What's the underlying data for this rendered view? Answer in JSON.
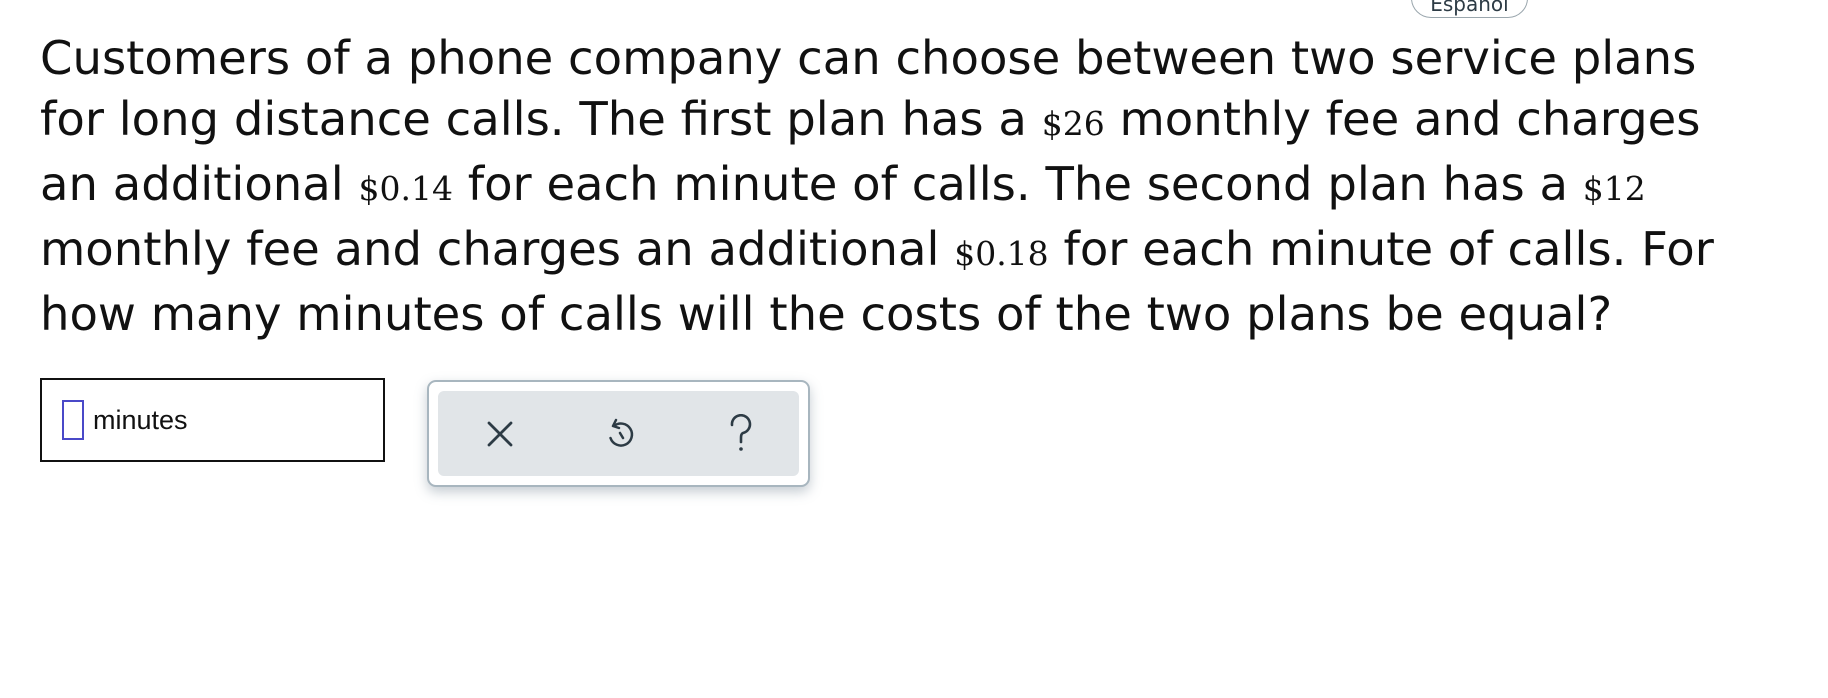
{
  "header": {
    "language_toggle": "Español"
  },
  "question": {
    "lines": [
      [
        "Customers of a phone company can choose between two service plans",
        "",
        ""
      ],
      [
        "for long distance calls. The first plan has a ",
        "$26",
        " monthly fee and charges"
      ],
      [
        "an additional ",
        "$0.14",
        " for each minute of calls. The second plan has a "
      ],
      [
        "monthly fee and charges an additional ",
        "$0.18",
        " for each minute of calls. For"
      ],
      [
        "how many minutes of calls will the costs of the two plans be equal?",
        "",
        ""
      ]
    ],
    "line3_trailing_money": "$12"
  },
  "answer": {
    "value": "",
    "unit": "minutes"
  },
  "tools": {
    "clear_icon": "close-icon",
    "undo_icon": "undo-icon",
    "help_icon": "help-icon"
  },
  "colors": {
    "input_cursor": "#4a49c8",
    "panel_border": "#a8b6bf",
    "panel_fill": "#e1e5e8",
    "icon_color": "#2d3b45"
  }
}
